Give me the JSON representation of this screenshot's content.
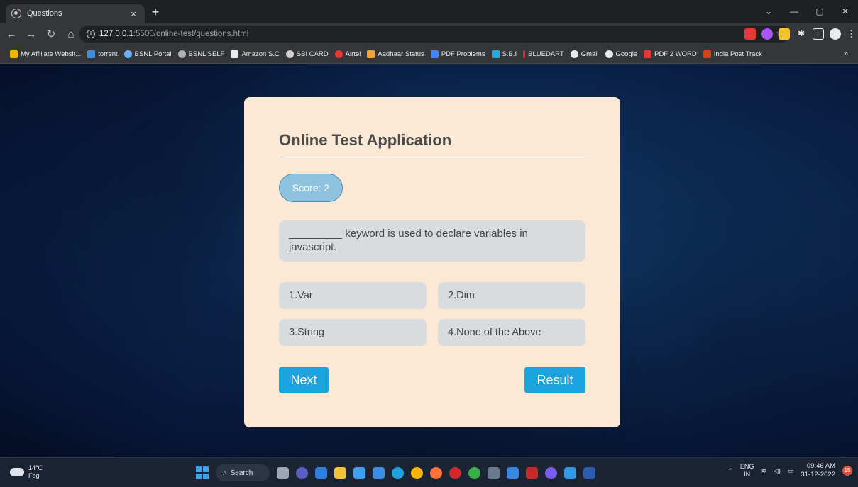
{
  "browser": {
    "tab_title": "Questions",
    "tab_close": "×",
    "new_tab": "+",
    "url_host": "127.0.0.1",
    "url_path": ":5500/online-test/questions.html",
    "bookmarks": [
      {
        "label": "My Affiliate Websit...",
        "color": "#f4b400"
      },
      {
        "label": "torrent",
        "color": "#3d8ee0"
      },
      {
        "label": "BSNL Portal",
        "color": "#6ab0ff"
      },
      {
        "label": "BSNL SELF",
        "color": "#b0b0b0"
      },
      {
        "label": "Amazon S.C",
        "color": "#e8eaed"
      },
      {
        "label": "SBI CARD",
        "color": "#cfcfcf"
      },
      {
        "label": "Airtel",
        "color": "#e53935"
      },
      {
        "label": "Aadhaar Status",
        "color": "#f2a33a"
      },
      {
        "label": "PDF Problems",
        "color": "#4285f4"
      },
      {
        "label": "S.B.I",
        "color": "#28a8e0"
      },
      {
        "label": "BLUEDART",
        "color": "#d32f2f"
      },
      {
        "label": "Gmail",
        "color": "#e8eaed"
      },
      {
        "label": "Google",
        "color": "#e8eaed"
      },
      {
        "label": "PDF 2 WORD",
        "color": "#e53935"
      },
      {
        "label": "India Post Track",
        "color": "#d84315"
      }
    ],
    "bookmarks_more": "»"
  },
  "app": {
    "title": "Online Test Application",
    "score_label": "Score: 2",
    "question": "_________ keyword is used to declare variables in javascript.",
    "options": [
      "1.Var",
      "2.Dim",
      "3.String",
      "4.None of the Above"
    ],
    "next_label": "Next",
    "result_label": "Result"
  },
  "taskbar": {
    "temp": "14°C",
    "condition": "Fog",
    "search_label": "Search",
    "lang_top": "ENG",
    "lang_bottom": "IN",
    "time": "09:46 AM",
    "date": "31-12-2022",
    "notifications": "15"
  }
}
